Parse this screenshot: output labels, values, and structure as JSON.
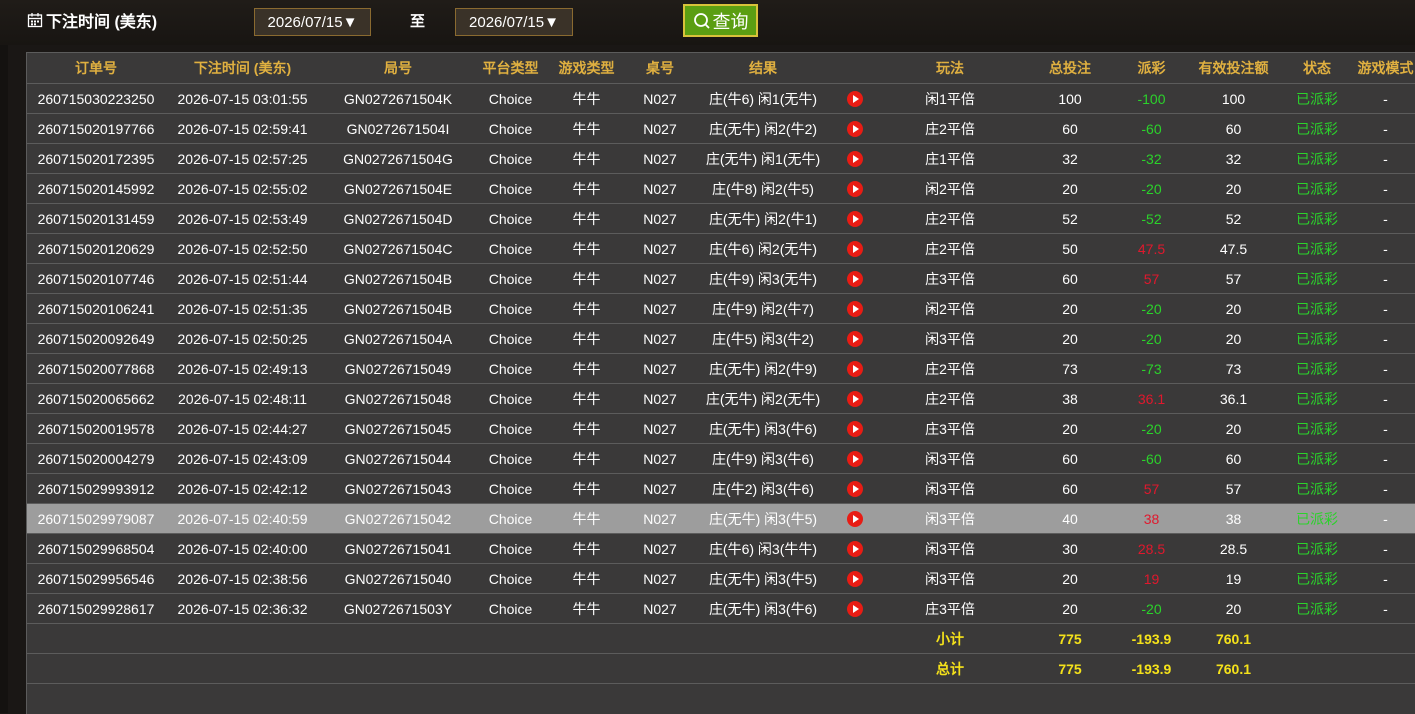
{
  "filter": {
    "label": "下注时间 (美东)",
    "date_from": "2026/07/15▼",
    "separator": "至",
    "date_to": "2026/07/15▼",
    "query_label": "查询"
  },
  "columns": [
    "订单号",
    "下注时间 (美东)",
    "局号",
    "平台类型",
    "游戏类型",
    "桌号",
    "结果",
    "",
    "玩法",
    "总投注",
    "派彩",
    "有效投注额",
    "状态",
    "游戏模式"
  ],
  "rows": [
    {
      "order": "260715030223250",
      "time": "2026-07-15 03:01:55",
      "round": "GN0272671504K",
      "platform": "Choice",
      "game": "牛牛",
      "table": "N027",
      "result": "庄(牛6) 闲1(无牛)",
      "play": "闲1平倍",
      "bet": "100",
      "payout": "-100",
      "valid": "100",
      "status": "已派彩",
      "mode": "-",
      "sign": "neg"
    },
    {
      "order": "260715020197766",
      "time": "2026-07-15 02:59:41",
      "round": "GN0272671504I",
      "platform": "Choice",
      "game": "牛牛",
      "table": "N027",
      "result": "庄(无牛) 闲2(牛2)",
      "play": "庄2平倍",
      "bet": "60",
      "payout": "-60",
      "valid": "60",
      "status": "已派彩",
      "mode": "-",
      "sign": "neg"
    },
    {
      "order": "260715020172395",
      "time": "2026-07-15 02:57:25",
      "round": "GN0272671504G",
      "platform": "Choice",
      "game": "牛牛",
      "table": "N027",
      "result": "庄(无牛) 闲1(无牛)",
      "play": "庄1平倍",
      "bet": "32",
      "payout": "-32",
      "valid": "32",
      "status": "已派彩",
      "mode": "-",
      "sign": "neg"
    },
    {
      "order": "260715020145992",
      "time": "2026-07-15 02:55:02",
      "round": "GN0272671504E",
      "platform": "Choice",
      "game": "牛牛",
      "table": "N027",
      "result": "庄(牛8) 闲2(牛5)",
      "play": "闲2平倍",
      "bet": "20",
      "payout": "-20",
      "valid": "20",
      "status": "已派彩",
      "mode": "-",
      "sign": "neg"
    },
    {
      "order": "260715020131459",
      "time": "2026-07-15 02:53:49",
      "round": "GN0272671504D",
      "platform": "Choice",
      "game": "牛牛",
      "table": "N027",
      "result": "庄(无牛) 闲2(牛1)",
      "play": "庄2平倍",
      "bet": "52",
      "payout": "-52",
      "valid": "52",
      "status": "已派彩",
      "mode": "-",
      "sign": "neg"
    },
    {
      "order": "260715020120629",
      "time": "2026-07-15 02:52:50",
      "round": "GN0272671504C",
      "platform": "Choice",
      "game": "牛牛",
      "table": "N027",
      "result": "庄(牛6) 闲2(无牛)",
      "play": "庄2平倍",
      "bet": "50",
      "payout": "47.5",
      "valid": "47.5",
      "status": "已派彩",
      "mode": "-",
      "sign": "pos"
    },
    {
      "order": "260715020107746",
      "time": "2026-07-15 02:51:44",
      "round": "GN0272671504B",
      "platform": "Choice",
      "game": "牛牛",
      "table": "N027",
      "result": "庄(牛9) 闲3(无牛)",
      "play": "庄3平倍",
      "bet": "60",
      "payout": "57",
      "valid": "57",
      "status": "已派彩",
      "mode": "-",
      "sign": "pos"
    },
    {
      "order": "260715020106241",
      "time": "2026-07-15 02:51:35",
      "round": "GN0272671504B",
      "platform": "Choice",
      "game": "牛牛",
      "table": "N027",
      "result": "庄(牛9) 闲2(牛7)",
      "play": "闲2平倍",
      "bet": "20",
      "payout": "-20",
      "valid": "20",
      "status": "已派彩",
      "mode": "-",
      "sign": "neg"
    },
    {
      "order": "260715020092649",
      "time": "2026-07-15 02:50:25",
      "round": "GN0272671504A",
      "platform": "Choice",
      "game": "牛牛",
      "table": "N027",
      "result": "庄(牛5) 闲3(牛2)",
      "play": "闲3平倍",
      "bet": "20",
      "payout": "-20",
      "valid": "20",
      "status": "已派彩",
      "mode": "-",
      "sign": "neg"
    },
    {
      "order": "260715020077868",
      "time": "2026-07-15 02:49:13",
      "round": "GN02726715049",
      "platform": "Choice",
      "game": "牛牛",
      "table": "N027",
      "result": "庄(无牛) 闲2(牛9)",
      "play": "庄2平倍",
      "bet": "73",
      "payout": "-73",
      "valid": "73",
      "status": "已派彩",
      "mode": "-",
      "sign": "neg"
    },
    {
      "order": "260715020065662",
      "time": "2026-07-15 02:48:11",
      "round": "GN02726715048",
      "platform": "Choice",
      "game": "牛牛",
      "table": "N027",
      "result": "庄(无牛) 闲2(无牛)",
      "play": "庄2平倍",
      "bet": "38",
      "payout": "36.1",
      "valid": "36.1",
      "status": "已派彩",
      "mode": "-",
      "sign": "pos"
    },
    {
      "order": "260715020019578",
      "time": "2026-07-15 02:44:27",
      "round": "GN02726715045",
      "platform": "Choice",
      "game": "牛牛",
      "table": "N027",
      "result": "庄(无牛) 闲3(牛6)",
      "play": "庄3平倍",
      "bet": "20",
      "payout": "-20",
      "valid": "20",
      "status": "已派彩",
      "mode": "-",
      "sign": "neg"
    },
    {
      "order": "260715020004279",
      "time": "2026-07-15 02:43:09",
      "round": "GN02726715044",
      "platform": "Choice",
      "game": "牛牛",
      "table": "N027",
      "result": "庄(牛9) 闲3(牛6)",
      "play": "闲3平倍",
      "bet": "60",
      "payout": "-60",
      "valid": "60",
      "status": "已派彩",
      "mode": "-",
      "sign": "neg"
    },
    {
      "order": "260715029993912",
      "time": "2026-07-15 02:42:12",
      "round": "GN02726715043",
      "platform": "Choice",
      "game": "牛牛",
      "table": "N027",
      "result": "庄(牛2) 闲3(牛6)",
      "play": "闲3平倍",
      "bet": "60",
      "payout": "57",
      "valid": "57",
      "status": "已派彩",
      "mode": "-",
      "sign": "pos"
    },
    {
      "order": "260715029979087",
      "time": "2026-07-15 02:40:59",
      "round": "GN02726715042",
      "platform": "Choice",
      "game": "牛牛",
      "table": "N027",
      "result": "庄(无牛) 闲3(牛5)",
      "play": "闲3平倍",
      "bet": "40",
      "payout": "38",
      "valid": "38",
      "status": "已派彩",
      "mode": "-",
      "sign": "pos",
      "highlight": true
    },
    {
      "order": "260715029968504",
      "time": "2026-07-15 02:40:00",
      "round": "GN02726715041",
      "platform": "Choice",
      "game": "牛牛",
      "table": "N027",
      "result": "庄(牛6) 闲3(牛牛)",
      "play": "闲3平倍",
      "bet": "30",
      "payout": "28.5",
      "valid": "28.5",
      "status": "已派彩",
      "mode": "-",
      "sign": "pos"
    },
    {
      "order": "260715029956546",
      "time": "2026-07-15 02:38:56",
      "round": "GN02726715040",
      "platform": "Choice",
      "game": "牛牛",
      "table": "N027",
      "result": "庄(无牛) 闲3(牛5)",
      "play": "闲3平倍",
      "bet": "20",
      "payout": "19",
      "valid": "19",
      "status": "已派彩",
      "mode": "-",
      "sign": "pos"
    },
    {
      "order": "260715029928617",
      "time": "2026-07-15 02:36:32",
      "round": "GN0272671503Y",
      "platform": "Choice",
      "game": "牛牛",
      "table": "N027",
      "result": "庄(无牛) 闲3(牛6)",
      "play": "庄3平倍",
      "bet": "20",
      "payout": "-20",
      "valid": "20",
      "status": "已派彩",
      "mode": "-",
      "sign": "neg"
    }
  ],
  "subtotal": {
    "label": "小计",
    "bet": "775",
    "payout": "-193.9",
    "valid": "760.1"
  },
  "total": {
    "label": "总计",
    "bet": "775",
    "payout": "-193.9",
    "valid": "760.1"
  },
  "colors": {
    "header_text": "#e0b040",
    "loss_green": "#2bd22b",
    "win_red": "#e0182d",
    "sum_yellow": "#f5e21a",
    "query_green": "#5b9e12"
  }
}
